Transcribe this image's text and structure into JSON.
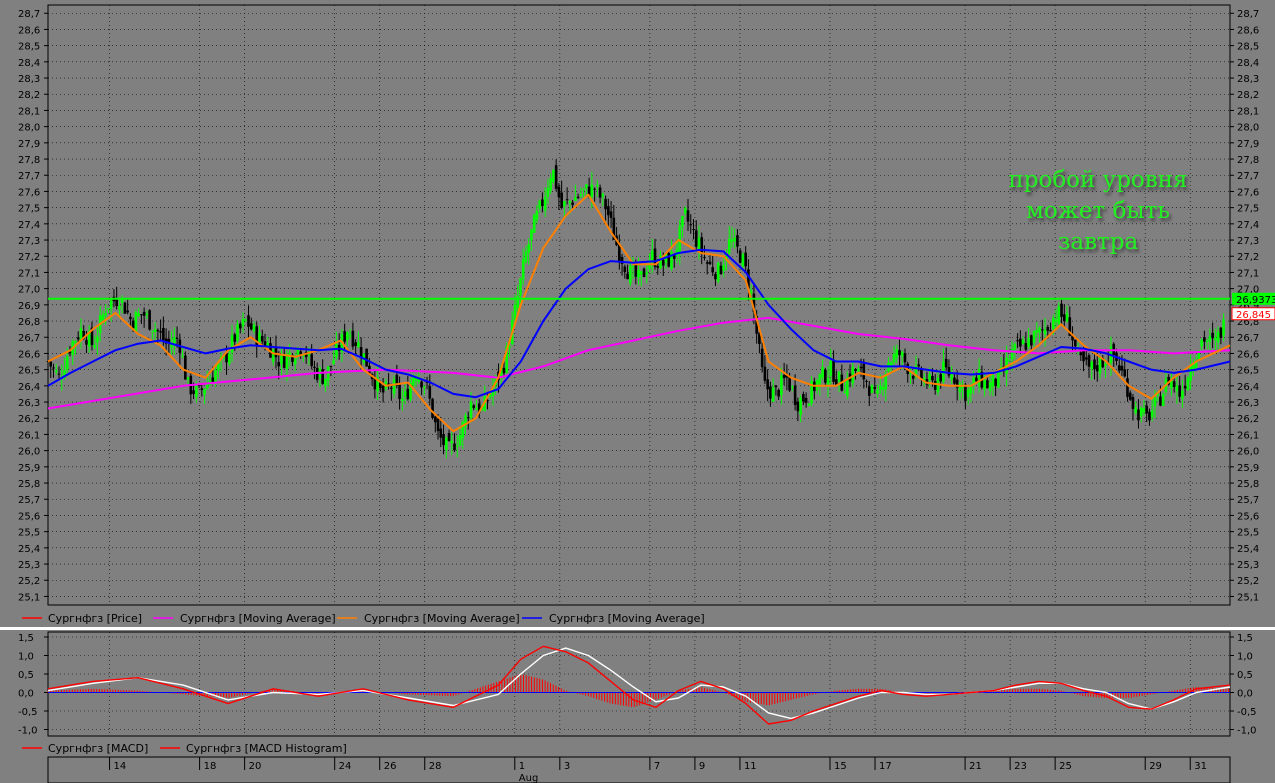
{
  "colors": {
    "background": "#808080",
    "grid": "#000000",
    "candle_up": "#00ff00",
    "candle_down": "#000000",
    "ma_long": "#ff00ff",
    "ma_mid": "#ff8000",
    "ma_short": "#0000ff",
    "level": "#00ff00",
    "macd": "#ff0000",
    "signal": "#ffffff",
    "histogram": "#ff0000",
    "zero_line": "#0000ff"
  },
  "chart_data": [
    {
      "type": "candlestick",
      "ylim": [
        25.0,
        28.7
      ],
      "y_ticks": [
        "28,7",
        "28,6",
        "28,5",
        "28,4",
        "28,3",
        "28,2",
        "28,1",
        "28,0",
        "27,9",
        "27,8",
        "27,7",
        "27,6",
        "27,5",
        "27,4",
        "27,3",
        "27,2",
        "27,1",
        "27,0",
        "26,9",
        "26,8",
        "26,7",
        "26,6",
        "26,5",
        "26,4",
        "26,3",
        "26,2",
        "26,1",
        "26,0",
        "25,9",
        "25,8",
        "25,7",
        "25,6",
        "25,5",
        "25,4",
        "25,3",
        "25,2",
        "25,1"
      ],
      "x_ticks": [
        {
          "label": "14",
          "day": 14
        },
        {
          "label": "18",
          "day": 18
        },
        {
          "label": "20",
          "day": 20
        },
        {
          "label": "24",
          "day": 24
        },
        {
          "label": "26",
          "day": 26
        },
        {
          "label": "28",
          "day": 28
        },
        {
          "label": "1",
          "day": 32
        },
        {
          "label": "3",
          "day": 34
        },
        {
          "label": "7",
          "day": 38
        },
        {
          "label": "9",
          "day": 40
        },
        {
          "label": "11",
          "day": 42
        },
        {
          "label": "15",
          "day": 46
        },
        {
          "label": "17",
          "day": 48
        },
        {
          "label": "21",
          "day": 52
        },
        {
          "label": "23",
          "day": 54
        },
        {
          "label": "25",
          "day": 56
        },
        {
          "label": "29",
          "day": 60
        },
        {
          "label": "31",
          "day": 62
        }
      ],
      "x_sublabel": "Aug",
      "day_range": [
        11.0,
        63.5
      ],
      "price_path": [
        [
          11.0,
          26.55
        ],
        [
          11.5,
          26.45
        ],
        [
          12.0,
          26.65
        ],
        [
          12.5,
          26.75
        ],
        [
          13.0,
          26.65
        ],
        [
          13.6,
          26.9
        ],
        [
          14.2,
          26.95
        ],
        [
          14.7,
          26.8
        ],
        [
          15.2,
          26.85
        ],
        [
          15.8,
          26.75
        ],
        [
          16.3,
          26.65
        ],
        [
          16.8,
          26.7
        ],
        [
          17.2,
          26.4
        ],
        [
          17.7,
          26.35
        ],
        [
          18.2,
          26.45
        ],
        [
          18.8,
          26.55
        ],
        [
          19.3,
          26.7
        ],
        [
          19.8,
          26.8
        ],
        [
          20.3,
          26.7
        ],
        [
          20.8,
          26.65
        ],
        [
          21.3,
          26.55
        ],
        [
          21.8,
          26.6
        ],
        [
          22.3,
          26.65
        ],
        [
          22.8,
          26.5
        ],
        [
          23.3,
          26.45
        ],
        [
          23.8,
          26.6
        ],
        [
          24.3,
          26.75
        ],
        [
          24.8,
          26.65
        ],
        [
          25.3,
          26.5
        ],
        [
          25.8,
          26.35
        ],
        [
          26.3,
          26.4
        ],
        [
          26.8,
          26.3
        ],
        [
          27.3,
          26.5
        ],
        [
          27.8,
          26.4
        ],
        [
          28.3,
          26.1
        ],
        [
          28.8,
          26.0
        ],
        [
          29.3,
          26.1
        ],
        [
          29.8,
          26.3
        ],
        [
          30.3,
          26.25
        ],
        [
          30.8,
          26.4
        ],
        [
          31.3,
          26.55
        ],
        [
          31.8,
          26.9
        ],
        [
          32.2,
          27.2
        ],
        [
          32.6,
          27.4
        ],
        [
          33.0,
          27.55
        ],
        [
          33.4,
          27.75
        ],
        [
          33.8,
          27.5
        ],
        [
          34.3,
          27.55
        ],
        [
          34.8,
          27.6
        ],
        [
          35.3,
          27.62
        ],
        [
          35.8,
          27.5
        ],
        [
          36.3,
          27.25
        ],
        [
          36.8,
          27.1
        ],
        [
          37.3,
          27.05
        ],
        [
          37.8,
          27.2
        ],
        [
          38.3,
          27.15
        ],
        [
          38.8,
          27.2
        ],
        [
          39.3,
          27.45
        ],
        [
          39.8,
          27.3
        ],
        [
          40.3,
          27.15
        ],
        [
          40.8,
          27.1
        ],
        [
          41.3,
          27.3
        ],
        [
          41.8,
          27.2
        ],
        [
          42.2,
          27.0
        ],
        [
          42.5,
          26.7
        ],
        [
          42.8,
          26.4
        ],
        [
          43.3,
          26.35
        ],
        [
          43.8,
          26.45
        ],
        [
          44.3,
          26.3
        ],
        [
          44.8,
          26.35
        ],
        [
          45.3,
          26.45
        ],
        [
          45.8,
          26.5
        ],
        [
          46.3,
          26.4
        ],
        [
          46.8,
          26.5
        ],
        [
          47.3,
          26.45
        ],
        [
          47.8,
          26.3
        ],
        [
          48.3,
          26.55
        ],
        [
          48.8,
          26.6
        ],
        [
          49.3,
          26.5
        ],
        [
          49.8,
          26.45
        ],
        [
          50.3,
          26.4
        ],
        [
          50.8,
          26.5
        ],
        [
          51.3,
          26.45
        ],
        [
          51.8,
          26.35
        ],
        [
          52.3,
          26.45
        ],
        [
          52.8,
          26.4
        ],
        [
          53.3,
          26.45
        ],
        [
          53.8,
          26.6
        ],
        [
          54.3,
          26.65
        ],
        [
          54.8,
          26.7
        ],
        [
          55.3,
          26.75
        ],
        [
          55.8,
          26.85
        ],
        [
          56.3,
          26.8
        ],
        [
          56.8,
          26.55
        ],
        [
          57.3,
          26.5
        ],
        [
          57.8,
          26.55
        ],
        [
          58.3,
          26.6
        ],
        [
          58.8,
          26.45
        ],
        [
          59.3,
          26.25
        ],
        [
          59.8,
          26.2
        ],
        [
          60.3,
          26.3
        ],
        [
          60.8,
          26.45
        ],
        [
          61.3,
          26.35
        ],
        [
          61.8,
          26.55
        ],
        [
          62.3,
          26.7
        ],
        [
          62.8,
          26.65
        ],
        [
          63.3,
          26.8
        ]
      ],
      "series": [
        {
          "name": "Сургнфгз [Price]",
          "legend_color": "#ff0000"
        },
        {
          "name": "Сургнфгз [Moving Average]",
          "legend_color": "#ff00ff",
          "x": [
            11,
            14,
            17,
            20,
            23,
            26,
            29,
            31,
            33,
            35,
            37,
            39,
            41,
            43,
            45,
            47,
            49,
            51,
            53,
            55,
            57,
            59,
            61,
            63.5
          ],
          "y": [
            26.26,
            26.33,
            26.4,
            26.44,
            26.48,
            26.5,
            26.48,
            26.45,
            26.52,
            26.62,
            26.68,
            26.74,
            26.79,
            26.82,
            26.77,
            26.72,
            26.69,
            26.65,
            26.62,
            26.6,
            26.62,
            26.62,
            26.6,
            26.62
          ]
        },
        {
          "name": "Сургнфгз [Moving Average]",
          "legend_color": "#ff8000",
          "x": [
            11,
            12,
            13,
            14,
            15,
            16,
            17,
            18,
            19,
            20,
            21,
            22,
            23,
            24,
            25,
            26,
            27,
            28,
            29,
            30,
            31,
            32,
            33,
            34,
            35,
            36,
            37,
            38,
            39,
            40,
            41,
            42,
            43,
            44,
            45,
            46,
            47,
            48,
            49,
            50,
            51,
            52,
            53,
            54,
            55,
            56,
            57,
            58,
            59,
            60,
            61,
            62,
            63.5
          ],
          "y": [
            26.55,
            26.62,
            26.75,
            26.85,
            26.72,
            26.65,
            26.5,
            26.45,
            26.62,
            26.7,
            26.6,
            26.58,
            26.62,
            26.68,
            26.5,
            26.4,
            26.42,
            26.25,
            26.12,
            26.2,
            26.45,
            26.9,
            27.25,
            27.45,
            27.58,
            27.35,
            27.15,
            27.15,
            27.3,
            27.22,
            27.2,
            27.05,
            26.55,
            26.45,
            26.4,
            26.4,
            26.48,
            26.45,
            26.52,
            26.42,
            26.4,
            26.4,
            26.48,
            26.55,
            26.65,
            26.78,
            26.65,
            26.55,
            26.4,
            26.32,
            26.45,
            26.55,
            26.65
          ]
        },
        {
          "name": "Сургнфгз [Moving Average]",
          "legend_color": "#0000ff",
          "x": [
            11,
            12,
            13,
            14,
            15,
            16,
            17,
            18,
            19,
            20,
            21,
            22,
            23,
            24,
            25,
            26,
            27,
            28,
            29,
            30,
            31,
            32,
            33,
            34,
            35,
            36,
            37,
            38,
            39,
            40,
            41,
            42,
            43,
            44,
            45,
            46,
            47,
            48,
            49,
            50,
            51,
            52,
            53,
            54,
            55,
            56,
            57,
            58,
            59,
            60,
            61,
            62,
            63.5
          ],
          "y": [
            26.4,
            26.48,
            26.55,
            26.62,
            26.66,
            26.68,
            26.64,
            26.6,
            26.63,
            26.65,
            26.64,
            26.63,
            26.62,
            26.63,
            26.57,
            26.5,
            26.47,
            26.42,
            26.35,
            26.33,
            26.38,
            26.55,
            26.8,
            27.0,
            27.12,
            27.17,
            27.16,
            27.17,
            27.22,
            27.24,
            27.23,
            27.1,
            26.9,
            26.75,
            26.62,
            26.55,
            26.55,
            26.52,
            26.52,
            26.5,
            26.48,
            26.47,
            26.48,
            26.52,
            26.58,
            26.64,
            26.63,
            26.6,
            26.55,
            26.5,
            26.48,
            26.5,
            26.55
          ]
        }
      ],
      "level_line": {
        "value": 26.9373,
        "label": "26,9373"
      },
      "last_price": {
        "value": 26.845,
        "label": "26,845"
      },
      "annotation": [
        "пробой уровня",
        "может быть",
        "завтра"
      ]
    },
    {
      "type": "macd",
      "ylim": [
        -1.0,
        1.5
      ],
      "y_ticks": [
        "1,5",
        "1,0",
        "0,5",
        "0,0",
        "-0,5",
        "-1,0"
      ],
      "series": [
        {
          "name": "Сургнфгз [MACD]",
          "legend_color": "#ff0000",
          "x": [
            11,
            13,
            15,
            17,
            19,
            21,
            23,
            25,
            27,
            29,
            31,
            32,
            33,
            34,
            35,
            36,
            37,
            38,
            39,
            40,
            41,
            42,
            43,
            44,
            45,
            46,
            47,
            48,
            49,
            50,
            51,
            52,
            53,
            54,
            55,
            56,
            57,
            58,
            59,
            60,
            61,
            62,
            63.5
          ],
          "y": [
            0.1,
            0.3,
            0.4,
            0.1,
            -0.3,
            0.1,
            -0.1,
            0.1,
            -0.2,
            -0.4,
            0.2,
            0.9,
            1.25,
            1.1,
            0.8,
            0.3,
            -0.2,
            -0.4,
            0.05,
            0.3,
            0.1,
            -0.3,
            -0.85,
            -0.75,
            -0.5,
            -0.3,
            -0.1,
            0.05,
            -0.05,
            -0.1,
            -0.05,
            0.0,
            0.05,
            0.2,
            0.3,
            0.25,
            0.05,
            -0.1,
            -0.4,
            -0.45,
            -0.2,
            0.1,
            0.2
          ]
        },
        {
          "name": "Сургнфгз [MACD Histogram]",
          "legend_color": "#ff0000",
          "x": [
            11,
            13,
            15,
            17,
            19,
            21,
            23,
            25,
            27,
            29,
            31,
            32,
            33,
            34,
            35,
            36,
            37,
            38,
            39,
            40,
            41,
            42,
            43,
            44,
            45,
            46,
            47,
            48,
            49,
            50,
            51,
            52,
            53,
            54,
            55,
            56,
            57,
            58,
            59,
            60,
            61,
            62,
            63.5
          ],
          "y": [
            0.05,
            0.1,
            0.05,
            -0.05,
            -0.15,
            0.1,
            -0.05,
            0.05,
            -0.05,
            -0.1,
            0.3,
            0.5,
            0.35,
            0.05,
            -0.1,
            -0.3,
            -0.4,
            -0.2,
            0.05,
            0.15,
            0.0,
            -0.25,
            -0.35,
            -0.2,
            -0.05,
            0.05,
            0.1,
            0.1,
            0.0,
            -0.05,
            0.0,
            0.02,
            0.05,
            0.1,
            0.1,
            0.05,
            -0.1,
            -0.15,
            -0.15,
            -0.05,
            0.05,
            0.15,
            0.1
          ]
        },
        {
          "name": "Signal",
          "x": [
            11,
            13,
            15,
            17,
            19,
            21,
            23,
            25,
            27,
            29,
            31,
            32,
            33,
            34,
            35,
            36,
            37,
            38,
            39,
            40,
            41,
            42,
            43,
            44,
            45,
            46,
            47,
            48,
            49,
            50,
            51,
            52,
            53,
            54,
            55,
            56,
            57,
            58,
            59,
            60,
            61,
            62,
            63.5
          ],
          "y": [
            0.05,
            0.25,
            0.4,
            0.2,
            -0.2,
            0.0,
            -0.05,
            0.05,
            -0.15,
            -0.35,
            -0.05,
            0.5,
            1.0,
            1.2,
            1.0,
            0.6,
            0.15,
            -0.25,
            -0.15,
            0.2,
            0.15,
            -0.1,
            -0.55,
            -0.7,
            -0.55,
            -0.35,
            -0.15,
            0.0,
            0.0,
            -0.05,
            -0.05,
            0.0,
            0.05,
            0.15,
            0.25,
            0.25,
            0.1,
            0.0,
            -0.3,
            -0.45,
            -0.25,
            0.0,
            0.15
          ]
        }
      ]
    }
  ]
}
